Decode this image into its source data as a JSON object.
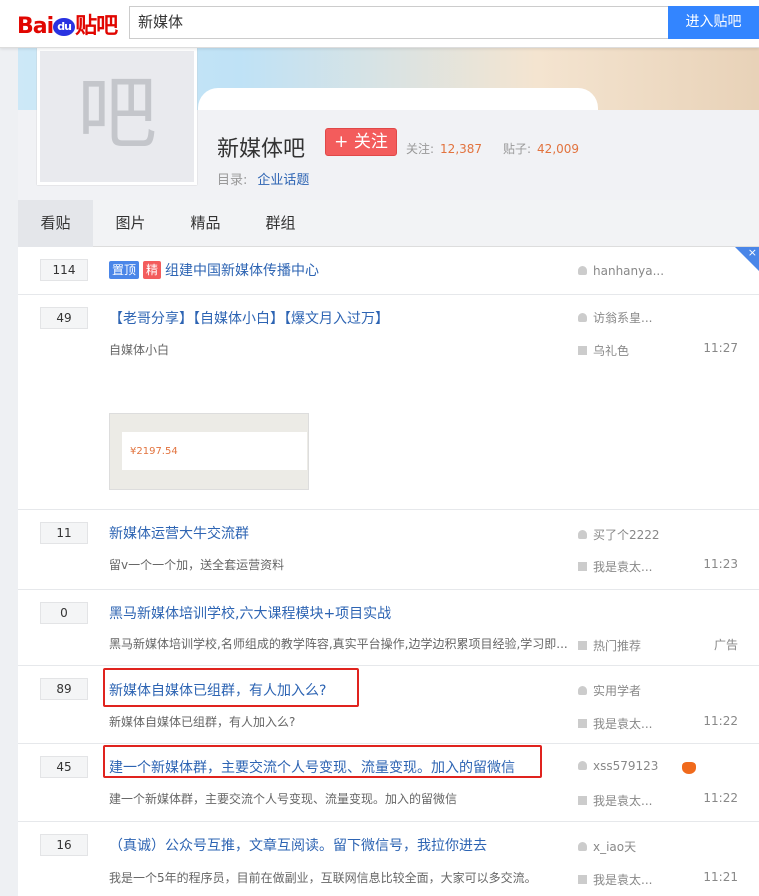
{
  "header": {
    "logo_text": "Bai",
    "logo_du": "du",
    "logo_suffix": "贴吧",
    "search_value": "新媒体",
    "enter_button": "进入贴吧"
  },
  "forum": {
    "avatar_char": "吧",
    "name": "新媒体吧",
    "follow_button": "+ 关注",
    "followers_label": "关注:",
    "followers": "12,387",
    "posts_label": "贴子:",
    "posts": "42,009",
    "directory_label": "目录:",
    "directory": "企业话题"
  },
  "tabs": [
    "看贴",
    "图片",
    "精品",
    "群组"
  ],
  "badges": {
    "top": "置顶",
    "good": "精"
  },
  "close_glyph": "×",
  "threads": [
    {
      "count": "114",
      "title": "组建中国新媒体传播中心",
      "author": "hanhanya..."
    },
    {
      "count": "49",
      "title": "【老哥分享】【自媒体小白】【爆文月入过万】",
      "abstract": "自媒体小白",
      "author": "访翁系皇...",
      "last_reply": "乌礼色",
      "time": "11:27",
      "thumb_amount": "¥2197.54"
    },
    {
      "count": "11",
      "title": "新媒体运营大牛交流群",
      "abstract": "留v一个一个加，送全套运营资料",
      "author": "买了个2222",
      "last_reply": "我是袁太...",
      "time": "11:23"
    },
    {
      "count": "0",
      "title": "黑马新媒体培训学校,六大课程模块+项目实战",
      "abstract": "黑马新媒体培训学校,名师组成的教学阵容,真实平台操作,边学边积累项目经验,学习即...",
      "author": "",
      "last_reply": "热门推荐",
      "time": "广告"
    },
    {
      "count": "89",
      "title": "新媒体自媒体已组群，有人加入么?",
      "abstract": "新媒体自媒体已组群，有人加入么?",
      "author": "实用学者",
      "last_reply": "我是袁太...",
      "time": "11:22"
    },
    {
      "count": "45",
      "title": "建一个新媒体群，主要交流个人号变现、流量变现。加入的留微信",
      "abstract": "建一个新媒体群，主要交流个人号变现、流量变现。加入的留微信",
      "author": "xss579123",
      "last_reply": "我是袁太...",
      "time": "11:22"
    },
    {
      "count": "16",
      "title": "（真诚）公众号互推，文章互阅读。留下微信号，我拉你进去",
      "abstract": "我是一个5年的程序员，目前在做副业，互联网信息比较全面，大家可以多交流。",
      "author": "x_iao天",
      "last_reply": "我是袁太...",
      "time": "11:21"
    }
  ]
}
